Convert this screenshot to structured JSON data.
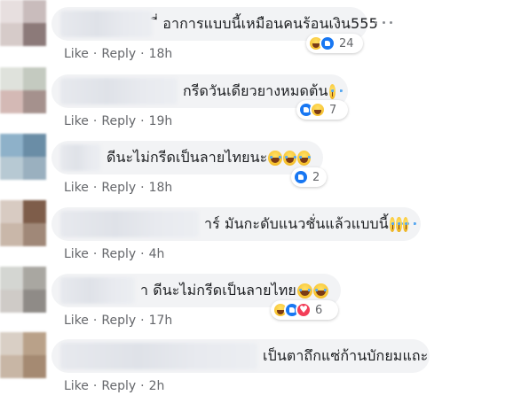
{
  "comments": [
    {
      "text": "ี่ อาการแบบนี้เหมือนคนร้อนเงิน555",
      "reaction_count": "24",
      "like_label": "Like",
      "reply_label": "Reply",
      "time": "18h",
      "reaction_types": [
        "haha",
        "like"
      ]
    },
    {
      "text": "กรีดวันเดียวยางหมดต้น",
      "reaction_count": "7",
      "like_label": "Like",
      "reply_label": "Reply",
      "time": "19h",
      "reaction_types": [
        "like",
        "haha"
      ]
    },
    {
      "text": "ดีนะไม่กรีดเป็นลายไทยนะ",
      "reaction_count": "2",
      "like_label": "Like",
      "reply_label": "Reply",
      "time": "18h",
      "reaction_types": [
        "like"
      ]
    },
    {
      "text": "าร์ มันกะดับแนวชั่นแล้วแบบนี้",
      "like_label": "Like",
      "reply_label": "Reply",
      "time": "4h"
    },
    {
      "text": "า ดีนะไม่กรีดเป็นลายไทย",
      "reaction_count": "6",
      "like_label": "Like",
      "reply_label": "Reply",
      "time": "17h",
      "reaction_types": [
        "haha",
        "like",
        "love"
      ]
    },
    {
      "text": "เป็นตาถึกแซ่ก้านบักยมแถะ",
      "like_label": "Like",
      "reply_label": "Reply",
      "time": "2h"
    }
  ],
  "colors": {
    "bubble": "#f2f3f5",
    "meta_text": "#65676b",
    "like_blue": "#1877f2",
    "love_red": "#f33e58",
    "haha_yellow": "#f7c12d"
  },
  "icons": [
    "more-options-icon",
    "like-reaction-icon",
    "haha-reaction-icon",
    "love-reaction-icon",
    "laughing-emoji-icon"
  ]
}
